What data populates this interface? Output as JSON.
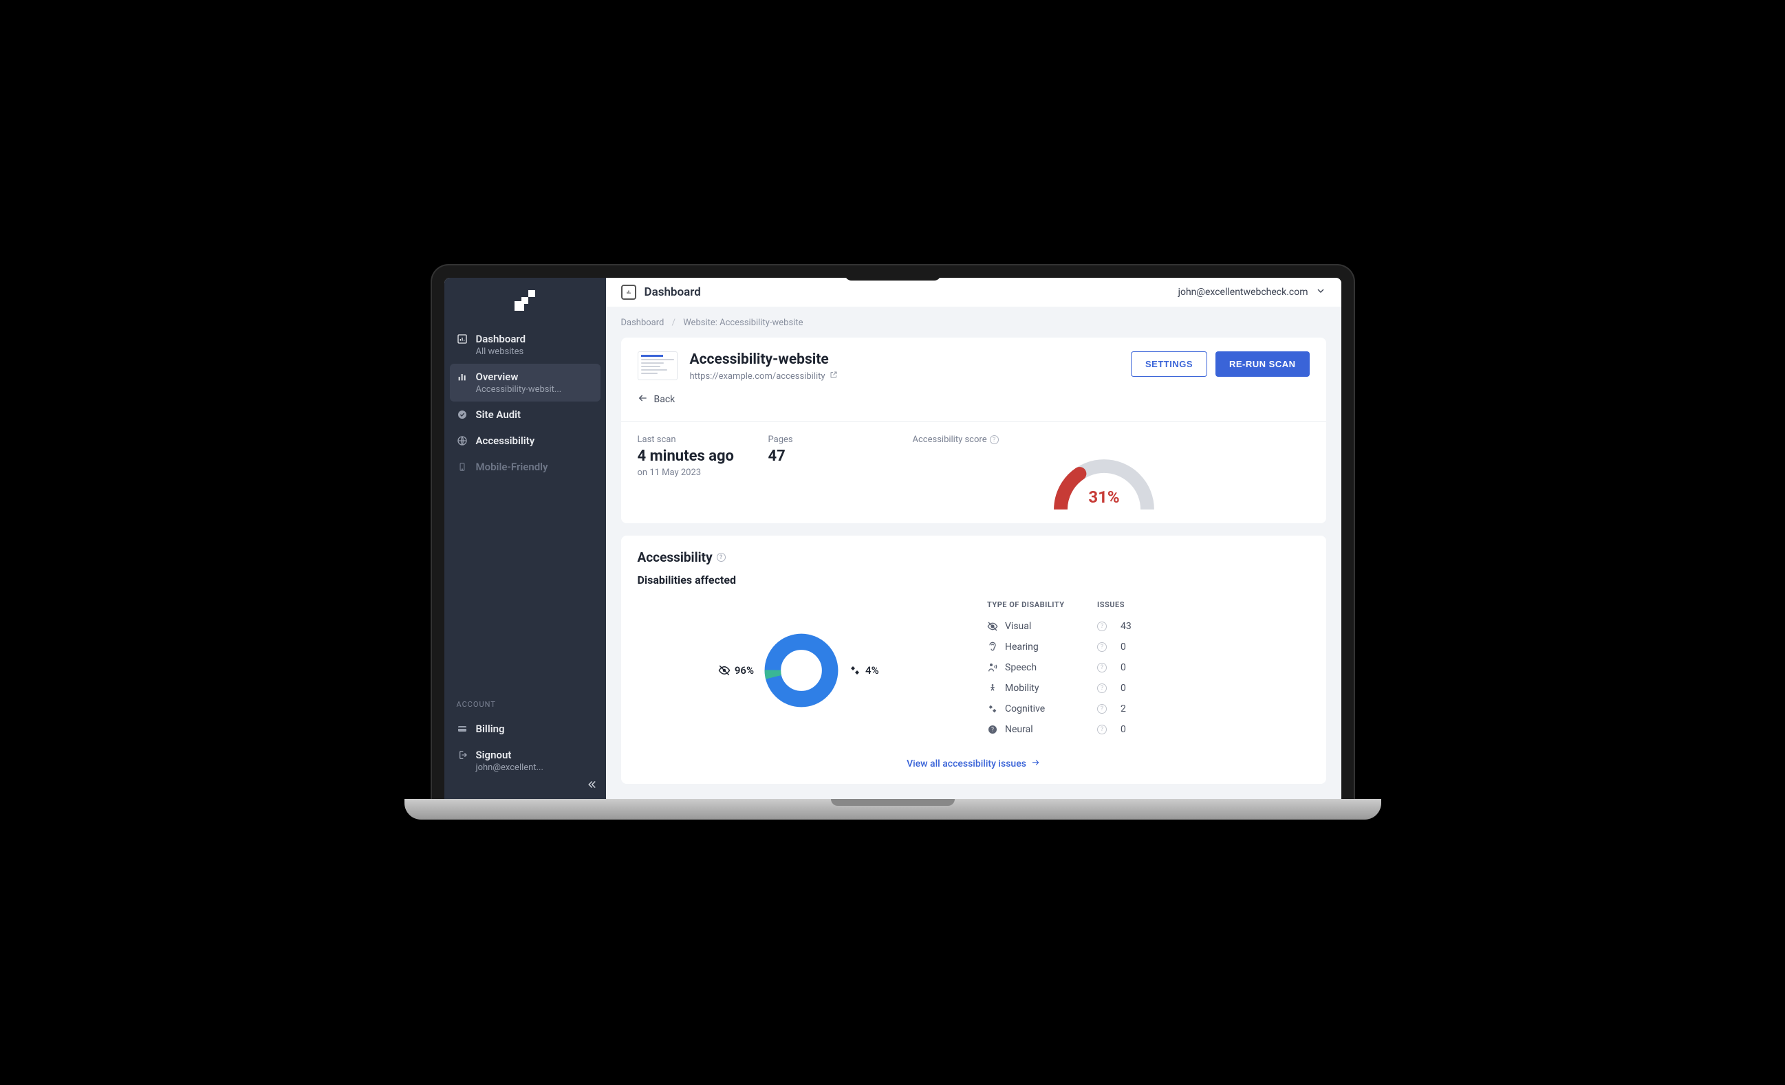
{
  "header": {
    "title": "Dashboard",
    "user_email": "john@excellentwebcheck.com"
  },
  "breadcrumb": {
    "root": "Dashboard",
    "current": "Website: Accessibility-website"
  },
  "sidebar": {
    "dashboard": {
      "label": "Dashboard",
      "sub": "All websites"
    },
    "overview": {
      "label": "Overview",
      "sub": "Accessibility-websit..."
    },
    "site_audit": {
      "label": "Site Audit"
    },
    "accessibility": {
      "label": "Accessibility"
    },
    "mobile_friendly": {
      "label": "Mobile-Friendly"
    },
    "account_header": "ACCOUNT",
    "billing": {
      "label": "Billing"
    },
    "signout": {
      "label": "Signout",
      "sub": "john@excellent..."
    }
  },
  "site": {
    "name": "Accessibility-website",
    "url": "https://example.com/accessibility",
    "settings_btn": "SETTINGS",
    "rerun_btn": "RE-RUN SCAN",
    "back": "Back"
  },
  "stats": {
    "last_scan_label": "Last scan",
    "last_scan_value": "4 minutes ago",
    "last_scan_date": "on 11 May 2023",
    "pages_label": "Pages",
    "pages_value": "47",
    "score_label": "Accessibility score",
    "score_value": "31%",
    "score_pct": 31
  },
  "accessibility": {
    "title": "Accessibility",
    "subtitle": "Disabilities affected",
    "donut": {
      "primary_label": "96%",
      "secondary_label": "4%",
      "primary_pct": 96
    },
    "table": {
      "head_a": "TYPE OF DISABILITY",
      "head_b": "ISSUES",
      "rows": [
        {
          "label": "Visual",
          "issues": "43"
        },
        {
          "label": "Hearing",
          "issues": "0"
        },
        {
          "label": "Speech",
          "issues": "0"
        },
        {
          "label": "Mobility",
          "issues": "0"
        },
        {
          "label": "Cognitive",
          "issues": "2"
        },
        {
          "label": "Neural",
          "issues": "0"
        }
      ]
    },
    "view_all": "View all accessibility issues"
  },
  "chart_data": [
    {
      "type": "pie",
      "title": "Disabilities affected",
      "series": [
        {
          "name": "Visual",
          "value": 96
        },
        {
          "name": "Cognitive",
          "value": 4
        }
      ]
    },
    {
      "type": "bar",
      "title": "Accessibility score",
      "categories": [
        "Score"
      ],
      "values": [
        31
      ],
      "ylim": [
        0,
        100
      ]
    }
  ]
}
